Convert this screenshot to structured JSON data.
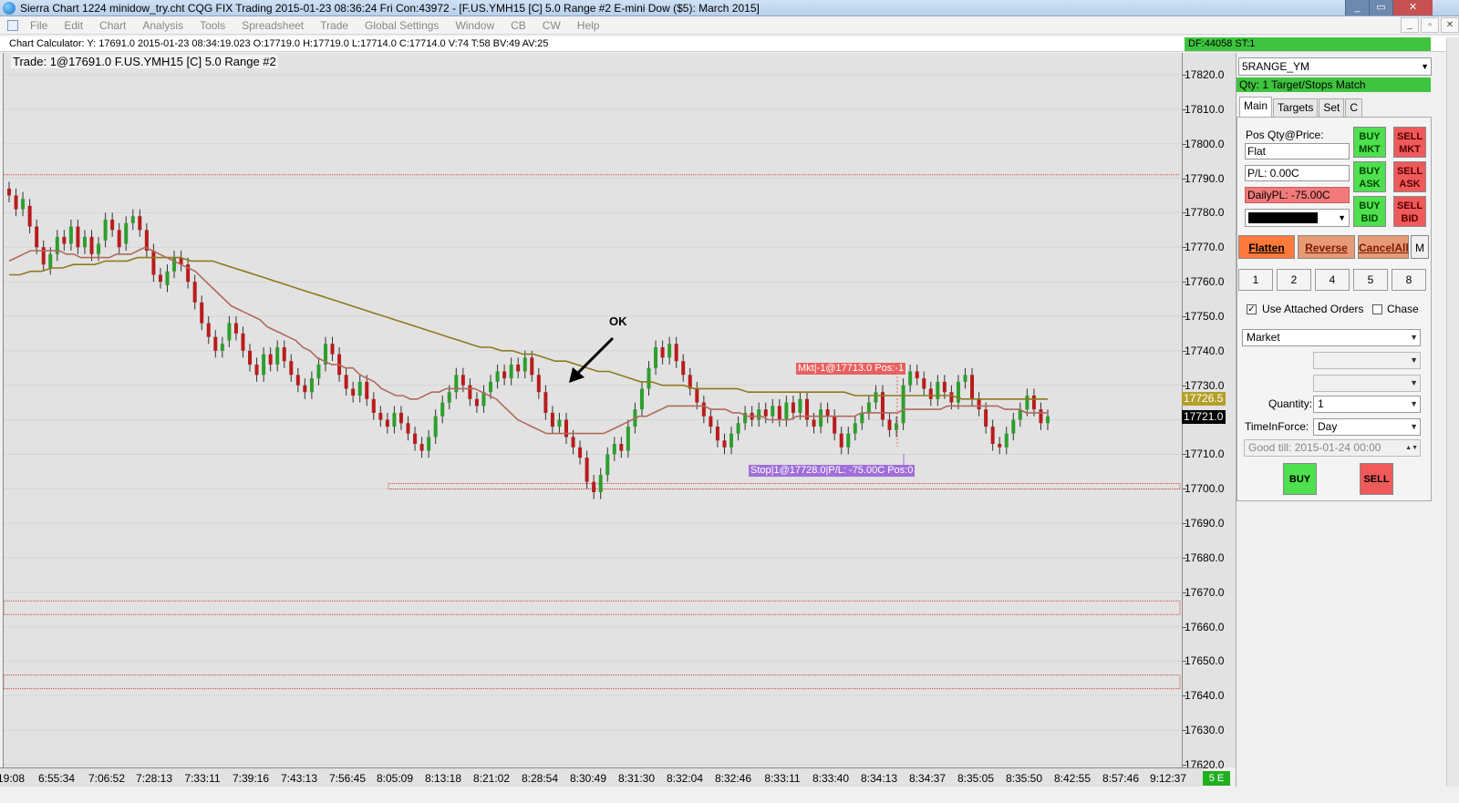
{
  "window": {
    "title": "Sierra Chart 1224 minidow_try.cht  CQG FIX Trading 2015-01-23  08:36:24 Fri  Con:43972 - [F.US.YMH15 [C]  5.0 Range  #2  E-mini Dow ($5): March 2015]",
    "controls": [
      "_",
      "▭",
      "✕"
    ]
  },
  "menu": {
    "items": [
      "File",
      "Edit",
      "Chart",
      "Analysis",
      "Tools",
      "Spreadsheet",
      "Trade",
      "Global Settings",
      "Window",
      "CB",
      "CW",
      "Help"
    ],
    "mdi_controls": [
      "_",
      "▫",
      "✕"
    ]
  },
  "calculator": {
    "text": "Chart Calculator: Y: 17691.0  2015-01-23  08:34:19.023  O:17719.0  H:17719.0  L:17714.0  C:17714.0  V:74  T:58  BV:49  AV:25"
  },
  "status": {
    "df": "DF:44058  ST:1"
  },
  "chart": {
    "header": "Trade:  1@17691.0  F.US.YMH15 [C]  5.0 Range  #2",
    "annotation": "OK",
    "mkt_order": "Mkt|-1@17713.0 Pos:-1",
    "stop_order": "Stop|1@17728.0|P/L: -75.00C Pos:0",
    "price_tag_ma": "17726.5",
    "price_tag_last": "17721.0",
    "x_badge": "5 E"
  },
  "chart_data": {
    "type": "candlestick",
    "y_ticks": [
      "17820.0",
      "17810.0",
      "17800.0",
      "17790.0",
      "17780.0",
      "17770.0",
      "17760.0",
      "17750.0",
      "17740.0",
      "17730.0",
      "17720.0",
      "17710.0",
      "17700.0",
      "17690.0",
      "17680.0",
      "17670.0",
      "17660.0",
      "17650.0",
      "17640.0",
      "17630.0",
      "17620.0"
    ],
    "x_ticks": [
      "19:08",
      "6:55:34",
      "7:06:52",
      "7:28:13",
      "7:33:11",
      "7:39:16",
      "7:43:13",
      "7:56:45",
      "8:05:09",
      "8:13:18",
      "8:21:02",
      "8:28:54",
      "8:30:49",
      "8:31:30",
      "8:32:04",
      "8:32:46",
      "8:33:11",
      "8:33:40",
      "8:34:13",
      "8:34:37",
      "8:35:05",
      "8:35:50",
      "8:42:55",
      "8:57:46",
      "9:12:37"
    ],
    "ylim": [
      17618,
      17825
    ],
    "closes": [
      17785,
      17781,
      17784,
      17776,
      17770,
      17765,
      17768,
      17773,
      17771,
      17776,
      17770,
      17773,
      17768,
      17771,
      17778,
      17775,
      17770,
      17777,
      17779,
      17775,
      17769,
      17762,
      17760,
      17763,
      17767,
      17765,
      17760,
      17754,
      17748,
      17744,
      17740,
      17742,
      17748,
      17745,
      17740,
      17736,
      17733,
      17739,
      17736,
      17741,
      17737,
      17733,
      17730,
      17728,
      17732,
      17736,
      17742,
      17739,
      17733,
      17729,
      17727,
      17731,
      17726,
      17722,
      17720,
      17718,
      17722,
      17719,
      17716,
      17713,
      17711,
      17715,
      17721,
      17725,
      17728,
      17733,
      17730,
      17726,
      17724,
      17728,
      17731,
      17734,
      17732,
      17736,
      17734,
      17738,
      17733,
      17728,
      17722,
      17718,
      17720,
      17715,
      17712,
      17709,
      17702,
      17699,
      17704,
      17710,
      17713,
      17711,
      17718,
      17723,
      17729,
      17735,
      17741,
      17738,
      17742,
      17737,
      17733,
      17729,
      17725,
      17721,
      17718,
      17714,
      17712,
      17716,
      17719,
      17722,
      17720,
      17723,
      17721,
      17724,
      17720,
      17725,
      17722,
      17726,
      17720,
      17718,
      17723,
      17721,
      17716,
      17712,
      17716,
      17719,
      17722,
      17725,
      17728,
      17720,
      17717,
      17719,
      17730,
      17734,
      17732,
      17729,
      17726,
      17731,
      17728,
      17725,
      17731,
      17733,
      17726,
      17723,
      17718,
      17713,
      17712,
      17716,
      17720,
      17723,
      17727,
      17723,
      17719,
      17721
    ],
    "opens": [
      17787,
      17785,
      17781,
      17782,
      17776,
      17770,
      17764,
      17768,
      17773,
      17771,
      17776,
      17770,
      17773,
      17768,
      17772,
      17778,
      17775,
      17771,
      17777,
      17779,
      17775,
      17769,
      17762,
      17759,
      17763,
      17767,
      17765,
      17760,
      17754,
      17748,
      17744,
      17740,
      17743,
      17748,
      17745,
      17740,
      17736,
      17733,
      17739,
      17736,
      17741,
      17737,
      17733,
      17730,
      17728,
      17732,
      17736,
      17742,
      17739,
      17733,
      17729,
      17727,
      17731,
      17726,
      17722,
      17720,
      17718,
      17722,
      17719,
      17716,
      17713,
      17711,
      17715,
      17721,
      17725,
      17728,
      17733,
      17730,
      17726,
      17724,
      17728,
      17731,
      17734,
      17732,
      17736,
      17734,
      17738,
      17733,
      17728,
      17722,
      17718,
      17720,
      17715,
      17712,
      17709,
      17702,
      17699,
      17704,
      17710,
      17713,
      17711,
      17718,
      17723,
      17729,
      17735,
      17741,
      17738,
      17742,
      17737,
      17733,
      17729,
      17725,
      17721,
      17718,
      17714,
      17712,
      17716,
      17719,
      17722,
      17720,
      17723,
      17721,
      17724,
      17720,
      17725,
      17722,
      17726,
      17720,
      17718,
      17723,
      17721,
      17716,
      17712,
      17716,
      17719,
      17722,
      17725,
      17728,
      17720,
      17717,
      17719,
      17730,
      17734,
      17732,
      17729,
      17726,
      17731,
      17728,
      17725,
      17731,
      17733,
      17726,
      17723,
      17718,
      17713,
      17712,
      17716,
      17720,
      17723,
      17727,
      17723,
      17719
    ],
    "ma_fast": [
      17766,
      17767,
      17768,
      17769,
      17769,
      17769,
      17769,
      17769,
      17768,
      17768,
      17767,
      17767,
      17767,
      17767,
      17767,
      17768,
      17768,
      17768,
      17769,
      17770,
      17769,
      17768,
      17767,
      17766,
      17765,
      17764,
      17763,
      17761,
      17759,
      17757,
      17755,
      17753,
      17752,
      17751,
      17750,
      17749,
      17747,
      17746,
      17745,
      17744,
      17743,
      17741,
      17740,
      17738,
      17737,
      17736,
      17736,
      17735,
      17735,
      17733,
      17732,
      17731,
      17729,
      17728,
      17727,
      17727,
      17726,
      17726,
      17727,
      17728,
      17728,
      17729,
      17729,
      17729,
      17729,
      17729,
      17728,
      17727,
      17726,
      17724,
      17722,
      17720,
      17719,
      17718,
      17717,
      17716,
      17716,
      17716,
      17716,
      17716,
      17716,
      17716,
      17716,
      17716,
      17717,
      17718,
      17719,
      17720,
      17721,
      17721,
      17722,
      17723,
      17724,
      17724,
      17724,
      17724,
      17724,
      17724,
      17723,
      17723,
      17723,
      17722,
      17722,
      17721,
      17721,
      17721,
      17720,
      17720,
      17720,
      17720,
      17721,
      17721,
      17721,
      17721,
      17721,
      17721,
      17721,
      17721,
      17721,
      17722,
      17722,
      17722,
      17722,
      17722,
      17722,
      17723,
      17723,
      17723,
      17723,
      17723,
      17723,
      17724,
      17724,
      17724,
      17724,
      17724,
      17724,
      17724,
      17724,
      17723,
      17723,
      17723,
      17722,
      17722,
      17722,
      17722
    ],
    "ma_slow": [
      17762,
      17762,
      17763,
      17763,
      17764,
      17764,
      17765,
      17765,
      17765,
      17766,
      17766,
      17766,
      17767,
      17767,
      17767,
      17767,
      17767,
      17766,
      17766,
      17766,
      17765,
      17764,
      17763,
      17762,
      17761,
      17760,
      17759,
      17758,
      17757,
      17756,
      17755,
      17754,
      17753,
      17752,
      17751,
      17750,
      17749,
      17748,
      17747,
      17746,
      17745,
      17744,
      17743,
      17742,
      17741,
      17741,
      17740,
      17740,
      17739,
      17739,
      17738,
      17737,
      17737,
      17736,
      17735,
      17734,
      17734,
      17733,
      17732,
      17731,
      17731,
      17730,
      17730,
      17730,
      17729,
      17729,
      17729,
      17729,
      17729,
      17728,
      17728,
      17728,
      17728,
      17728,
      17728,
      17728,
      17728,
      17728,
      17728,
      17727,
      17727,
      17727,
      17727,
      17727,
      17727,
      17727,
      17727,
      17727,
      17727,
      17726,
      17726,
      17726,
      17726,
      17726,
      17726,
      17726,
      17726,
      17726
    ]
  },
  "panel": {
    "symbol": "5RANGE_YM",
    "qty_bar": "Qty: 1 Target/Stops Match",
    "tabs": [
      "Main",
      "Targets",
      "Set",
      "C"
    ],
    "pos_label": "Pos Qty@Price:",
    "pos_value": "Flat",
    "pl": "P/L: 0.00C",
    "daily_pl": "DailyPL: -75.00C",
    "buttons": {
      "buy_mkt": [
        "BUY",
        "MKT"
      ],
      "sell_mkt": [
        "SELL",
        "MKT"
      ],
      "buy_ask": [
        "BUY",
        "ASK"
      ],
      "sell_ask": [
        "SELL",
        "ASK"
      ],
      "buy_bid": [
        "BUY",
        "BID"
      ],
      "sell_bid": [
        "SELL",
        "BID"
      ],
      "flatten": "Flatten",
      "reverse": "Reverse",
      "cancel_all": "CancelAll",
      "m": "M",
      "qty_presets": [
        "1",
        "2",
        "4",
        "5",
        "8"
      ],
      "buy": "BUY",
      "sell": "SELL"
    },
    "use_attached": "Use Attached Orders",
    "chase": "Chase",
    "order_type": "Market",
    "quantity_label": "Quantity:",
    "quantity_value": "1",
    "tif_label": "TimeInForce:",
    "tif_value": "Day",
    "good_till": "Good till: 2015-01-24 00:00"
  }
}
